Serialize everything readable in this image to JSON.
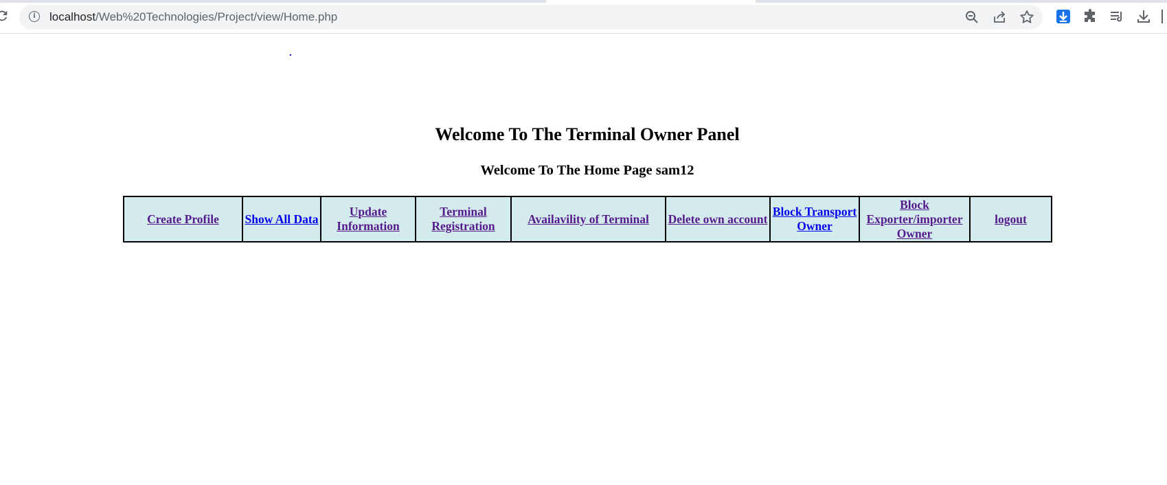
{
  "browser": {
    "url_host": "localhost",
    "url_path": "/Web%20Technologies/Project/view/Home.php"
  },
  "page": {
    "title": "Welcome To The Terminal Owner Panel",
    "welcome": "Welcome To The Home Page sam12"
  },
  "nav": {
    "links": [
      {
        "label": "Create Profile",
        "visited": true
      },
      {
        "label": "Show All Data",
        "visited": false
      },
      {
        "label": "Update Information",
        "visited": true
      },
      {
        "label": "Terminal Registration",
        "visited": true
      },
      {
        "label": "Availavility of Terminal",
        "visited": true
      },
      {
        "label": "Delete own account",
        "visited": true
      },
      {
        "label": "Block Transport Owner",
        "visited": false
      },
      {
        "label": "Block Exporter/importer Owner",
        "visited": true
      },
      {
        "label": "logout",
        "visited": true
      }
    ]
  },
  "colors": {
    "cell_background": "#d4ebed",
    "visited_link": "#551a8b",
    "unvisited_link": "#0000ee"
  },
  "icons": [
    "reload-icon",
    "info-icon",
    "zoom-out-icon",
    "share-icon",
    "bookmark-star-icon",
    "extension-download-icon",
    "puzzle-extensions-icon",
    "reading-list-icon",
    "downloads-icon"
  ]
}
